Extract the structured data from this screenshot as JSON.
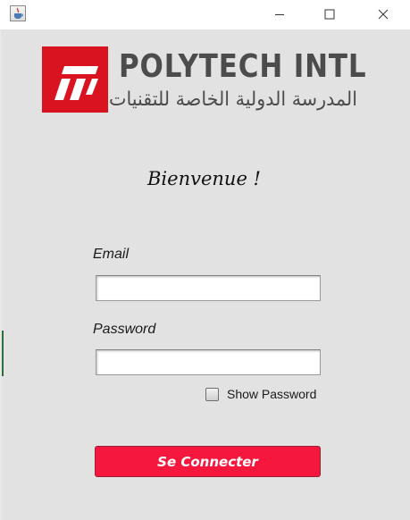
{
  "window": {
    "icon": "java-icon",
    "controls": {
      "minimize_icon": "minimize-icon",
      "maximize_icon": "maximize-icon",
      "close_icon": "close-icon"
    }
  },
  "logo": {
    "name": "POLYTECH INTL",
    "arabic": "المدرسة الدولية الخاصة للتقنيات",
    "brand_color": "#d9131f"
  },
  "welcome_text": "Bienvenue !",
  "form": {
    "email_label": "Email",
    "email_value": "",
    "password_label": "Password",
    "password_value": "",
    "show_password_label": "Show Password",
    "show_password_checked": false,
    "submit_label": "Se Connecter",
    "submit_color": "#f5173e"
  }
}
